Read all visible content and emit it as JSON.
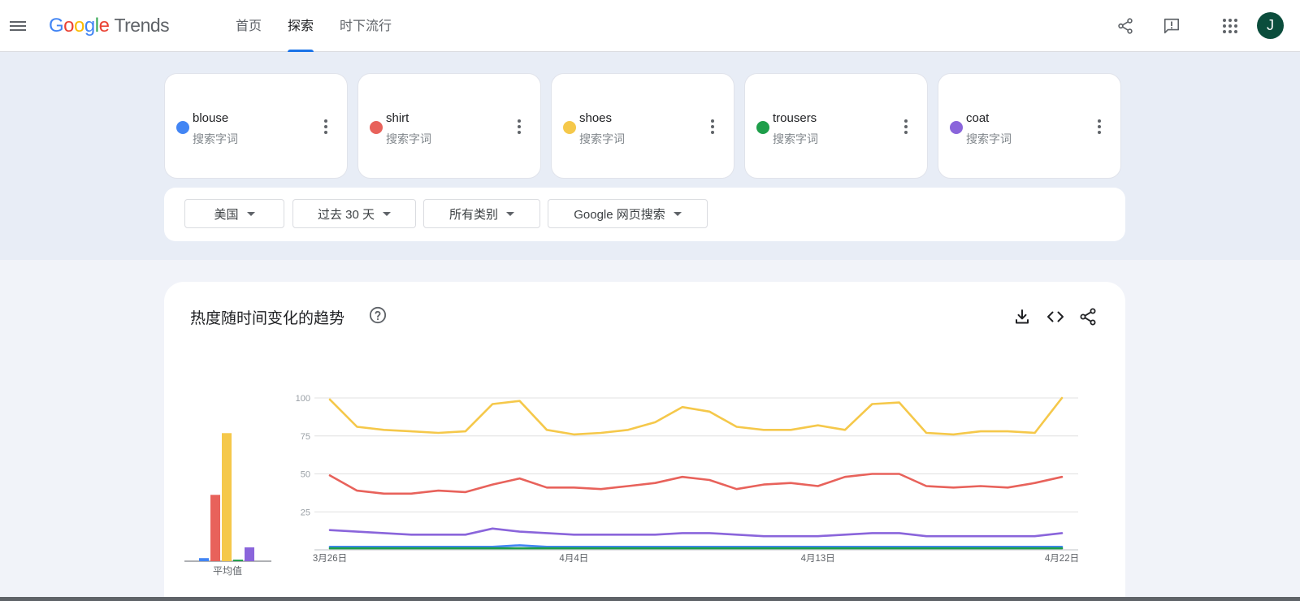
{
  "header": {
    "logo_google": "Google",
    "logo_product": "Trends",
    "nav": [
      {
        "label": "首页",
        "active": false
      },
      {
        "label": "探索",
        "active": true
      },
      {
        "label": "时下流行",
        "active": false
      }
    ],
    "avatar_initial": "J"
  },
  "terms": [
    {
      "name": "blouse",
      "type": "搜索字词",
      "color": "#4285f4"
    },
    {
      "name": "shirt",
      "type": "搜索字词",
      "color": "#e8625b"
    },
    {
      "name": "shoes",
      "type": "搜索字词",
      "color": "#f5c84a"
    },
    {
      "name": "trousers",
      "type": "搜索字词",
      "color": "#1e9e4a"
    },
    {
      "name": "coat",
      "type": "搜索字词",
      "color": "#8a65db"
    }
  ],
  "filters": {
    "region": "美国",
    "time": "过去 30 天",
    "category": "所有类别",
    "search_type": "Google 网页搜索"
  },
  "chart": {
    "title": "热度随时间变化的趋势",
    "average_label": "平均值"
  },
  "chart_data": [
    {
      "type": "bar",
      "xlabel": "平均值",
      "series": [
        {
          "name": "blouse",
          "value": 2,
          "color": "#4285f4"
        },
        {
          "name": "shirt",
          "value": 43,
          "color": "#e8625b"
        },
        {
          "name": "shoes",
          "value": 83,
          "color": "#f5c84a"
        },
        {
          "name": "trousers",
          "value": 1,
          "color": "#1e9e4a"
        },
        {
          "name": "coat",
          "value": 9,
          "color": "#8a65db"
        }
      ],
      "ylim": [
        0,
        100
      ]
    },
    {
      "type": "line",
      "ylim": [
        0,
        100
      ],
      "yticks": [
        25,
        50,
        75,
        100
      ],
      "xtick_labels": [
        {
          "label": "3月26日",
          "index": 0
        },
        {
          "label": "4月4日",
          "index": 9
        },
        {
          "label": "4月13日",
          "index": 18
        },
        {
          "label": "4月22日",
          "index": 27
        }
      ],
      "series": [
        {
          "name": "shoes",
          "color": "#f5c84a",
          "values": [
            99,
            81,
            79,
            78,
            77,
            78,
            96,
            98,
            79,
            76,
            77,
            79,
            84,
            94,
            91,
            81,
            79,
            79,
            82,
            79,
            96,
            97,
            77,
            76,
            78,
            78,
            77,
            100
          ]
        },
        {
          "name": "shirt",
          "color": "#e8625b",
          "values": [
            49,
            39,
            37,
            37,
            39,
            38,
            43,
            47,
            41,
            41,
            40,
            42,
            44,
            48,
            46,
            40,
            43,
            44,
            42,
            48,
            50,
            50,
            42,
            41,
            42,
            41,
            44,
            48
          ]
        },
        {
          "name": "coat",
          "color": "#8a65db",
          "values": [
            13,
            12,
            11,
            10,
            10,
            10,
            14,
            12,
            11,
            10,
            10,
            10,
            10,
            11,
            11,
            10,
            9,
            9,
            9,
            10,
            11,
            11,
            9,
            9,
            9,
            9,
            9,
            11
          ]
        },
        {
          "name": "blouse",
          "color": "#4285f4",
          "values": [
            2,
            2,
            2,
            2,
            2,
            2,
            2,
            3,
            2,
            2,
            2,
            2,
            2,
            2,
            2,
            2,
            2,
            2,
            2,
            2,
            2,
            2,
            2,
            2,
            2,
            2,
            2,
            2
          ]
        },
        {
          "name": "trousers",
          "color": "#1e9e4a",
          "values": [
            1,
            1,
            1,
            1,
            1,
            1,
            1,
            1,
            1,
            1,
            1,
            1,
            1,
            1,
            1,
            1,
            1,
            1,
            1,
            1,
            1,
            1,
            1,
            1,
            1,
            1,
            1,
            1
          ]
        }
      ]
    }
  ]
}
